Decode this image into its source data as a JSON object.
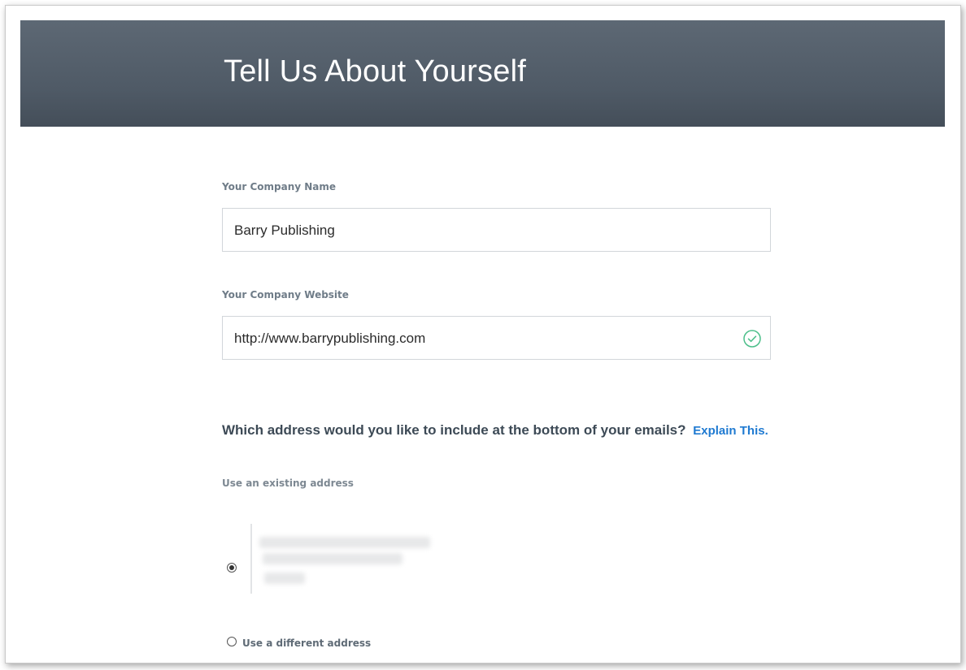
{
  "header": {
    "title": "Tell Us About Yourself"
  },
  "form": {
    "company_name": {
      "label": "Your Company Name",
      "value": "Barry Publishing"
    },
    "company_website": {
      "label": "Your Company Website",
      "value": "http://www.barrypublishing.com",
      "status_icon": "check-circle-icon"
    },
    "address_question": {
      "text": "Which address would you like to include at the bottom of your emails?",
      "link_text": "Explain This."
    },
    "existing_address": {
      "label": "Use an existing address",
      "selected": true
    },
    "different_address": {
      "label": "Use a different address",
      "selected": false
    }
  },
  "colors": {
    "header_bg": "#56616d",
    "label": "#6f7c88",
    "link": "#1f7ad1",
    "valid": "#4cbf8a"
  }
}
